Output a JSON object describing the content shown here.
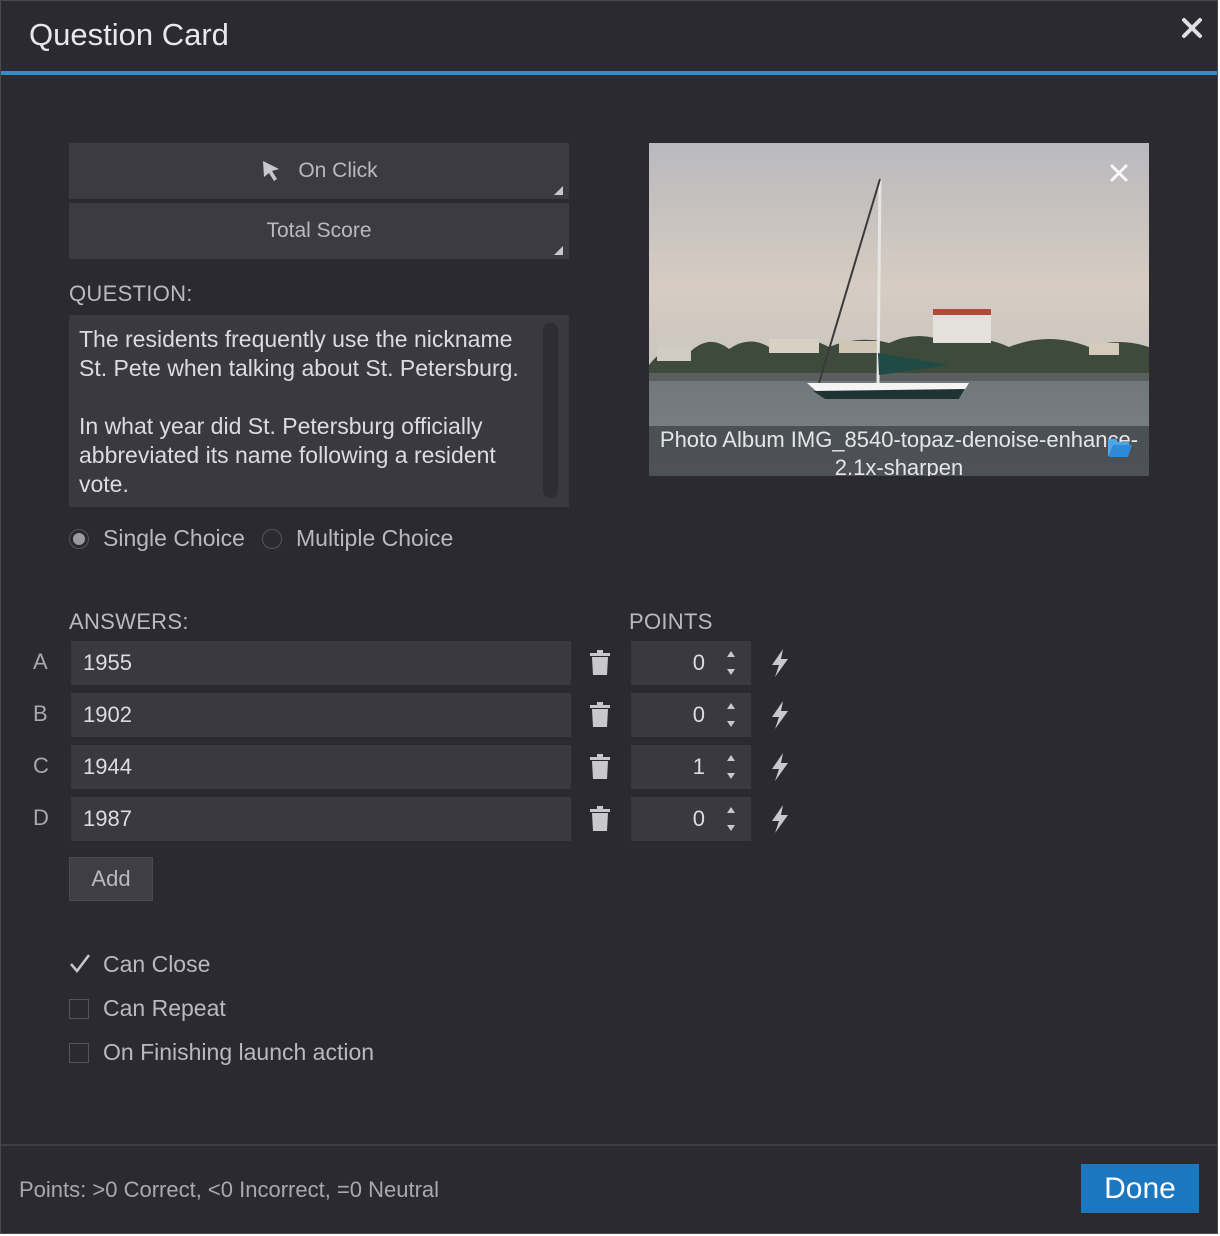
{
  "dialog": {
    "title": "Question Card",
    "accent_color": "#2d8fc7"
  },
  "trigger_dropdown": {
    "label": "On Click",
    "icon": "cursor-icon"
  },
  "score_dropdown": {
    "label": "Total Score"
  },
  "question": {
    "label": "QUESTION:",
    "text": "The residents frequently use the nickname St. Pete when talking about St. Petersburg.\n\nIn what year did St. Petersburg officially abbreviated its name following a resident vote."
  },
  "choice_mode": {
    "options": [
      "Single Choice",
      "Multiple Choice"
    ],
    "selected": "Single Choice"
  },
  "image": {
    "caption": "Photo Album IMG_8540-topaz-denoise-enhance-2.1x-sharpen"
  },
  "answers": {
    "label": "ANSWERS:",
    "points_label": "POINTS",
    "rows": [
      {
        "letter": "A",
        "value": "1955",
        "points": "0"
      },
      {
        "letter": "B",
        "value": "1902",
        "points": "0"
      },
      {
        "letter": "C",
        "value": "1944",
        "points": "1"
      },
      {
        "letter": "D",
        "value": "1987",
        "points": "0"
      }
    ],
    "add_label": "Add"
  },
  "options": [
    {
      "label": "Can Close",
      "checked": true
    },
    {
      "label": "Can Repeat",
      "checked": false
    },
    {
      "label": "On Finishing launch action",
      "checked": false
    }
  ],
  "footer": {
    "hint": "Points: >0 Correct, <0 Incorrect, =0 Neutral",
    "done_label": "Done",
    "done_color": "#1a77c0"
  }
}
